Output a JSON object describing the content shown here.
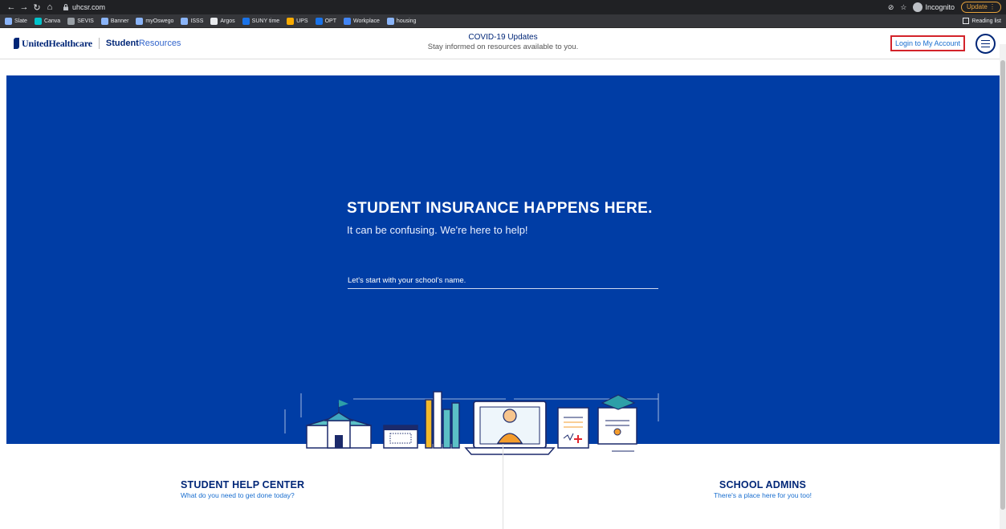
{
  "browser": {
    "url": "uhcsr.com",
    "incognito_label": "Incognito",
    "update_label": "Update",
    "reading_list_label": "Reading list",
    "bookmarks": [
      {
        "label": "Slate",
        "color": "#8ab4f8"
      },
      {
        "label": "Canva",
        "color": "#00c4cc"
      },
      {
        "label": "SEVIS",
        "color": "#9aa0a6"
      },
      {
        "label": "Banner",
        "color": "#8ab4f8"
      },
      {
        "label": "myOswego",
        "color": "#8ab4f8"
      },
      {
        "label": "ISSS",
        "color": "#8ab4f8"
      },
      {
        "label": "Argos",
        "color": "#e8eaed"
      },
      {
        "label": "SUNY time",
        "color": "#1a73e8"
      },
      {
        "label": "UPS",
        "color": "#f9ab00"
      },
      {
        "label": "OPT",
        "color": "#1a73e8"
      },
      {
        "label": "Workplace",
        "color": "#4285f4"
      },
      {
        "label": "housing",
        "color": "#8ab4f8"
      }
    ]
  },
  "header": {
    "logo_text": "UnitedHealthcare",
    "product_bold": "Student",
    "product_light": "Resources",
    "covid_title": "COVID-19 Updates",
    "covid_sub": "Stay informed on resources available to you.",
    "login_label": "Login to My Account"
  },
  "hero": {
    "title": "STUDENT INSURANCE HAPPENS HERE.",
    "subtitle": "It can be confusing. We're here to help!",
    "search_placeholder": "Let's start with your school's name.",
    "background": "#003da5"
  },
  "sections": {
    "help_title": "STUDENT HELP CENTER",
    "help_sub": "What do you need to get done today?",
    "admins_title": "SCHOOL ADMINS",
    "admins_sub": "There's a place here for you too!"
  },
  "colors": {
    "brand_navy": "#002677",
    "link_blue": "#196ecf",
    "highlight_red": "#d3232a"
  }
}
